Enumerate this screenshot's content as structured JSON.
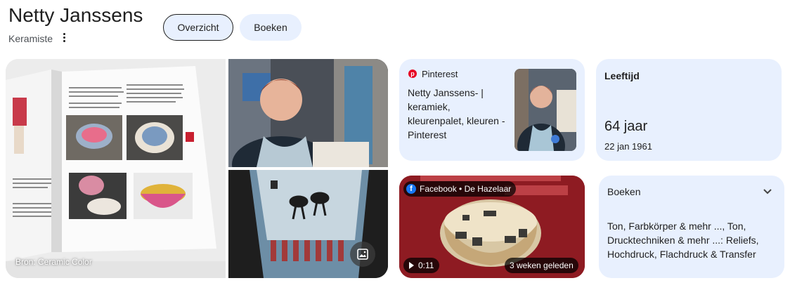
{
  "entity": {
    "name": "Netty Janssens",
    "subtitle": "Keramiste"
  },
  "tabs": [
    {
      "label": "Overzicht"
    },
    {
      "label": "Boeken"
    }
  ],
  "images": {
    "main_source_caption": "Bron: Ceramic Color",
    "gallery_icon": "image-gallery-icon"
  },
  "pinterest": {
    "source": "Pinterest",
    "title": "Netty Janssens- | keramiek, kleurenpalet, kleuren - Pinterest"
  },
  "age": {
    "label": "Leeftijd",
    "value": "64 jaar",
    "birthdate": "22 jan 1961"
  },
  "video": {
    "source": "Facebook • De Hazelaar",
    "duration": "0:11",
    "posted": "3 weken geleden"
  },
  "books": {
    "label": "Boeken",
    "text": "Ton, Farbkörper & mehr ..., Ton, Drucktechniken & mehr ...: Reliefs, Hochdruck, Flachdruck & Transfer"
  },
  "colors": {
    "chip_bg": "#e8f0fe",
    "card_bg": "#e8f0fe",
    "pinterest_red": "#e60023",
    "facebook_blue": "#1877f2",
    "video_bg": "#8e1b22"
  }
}
